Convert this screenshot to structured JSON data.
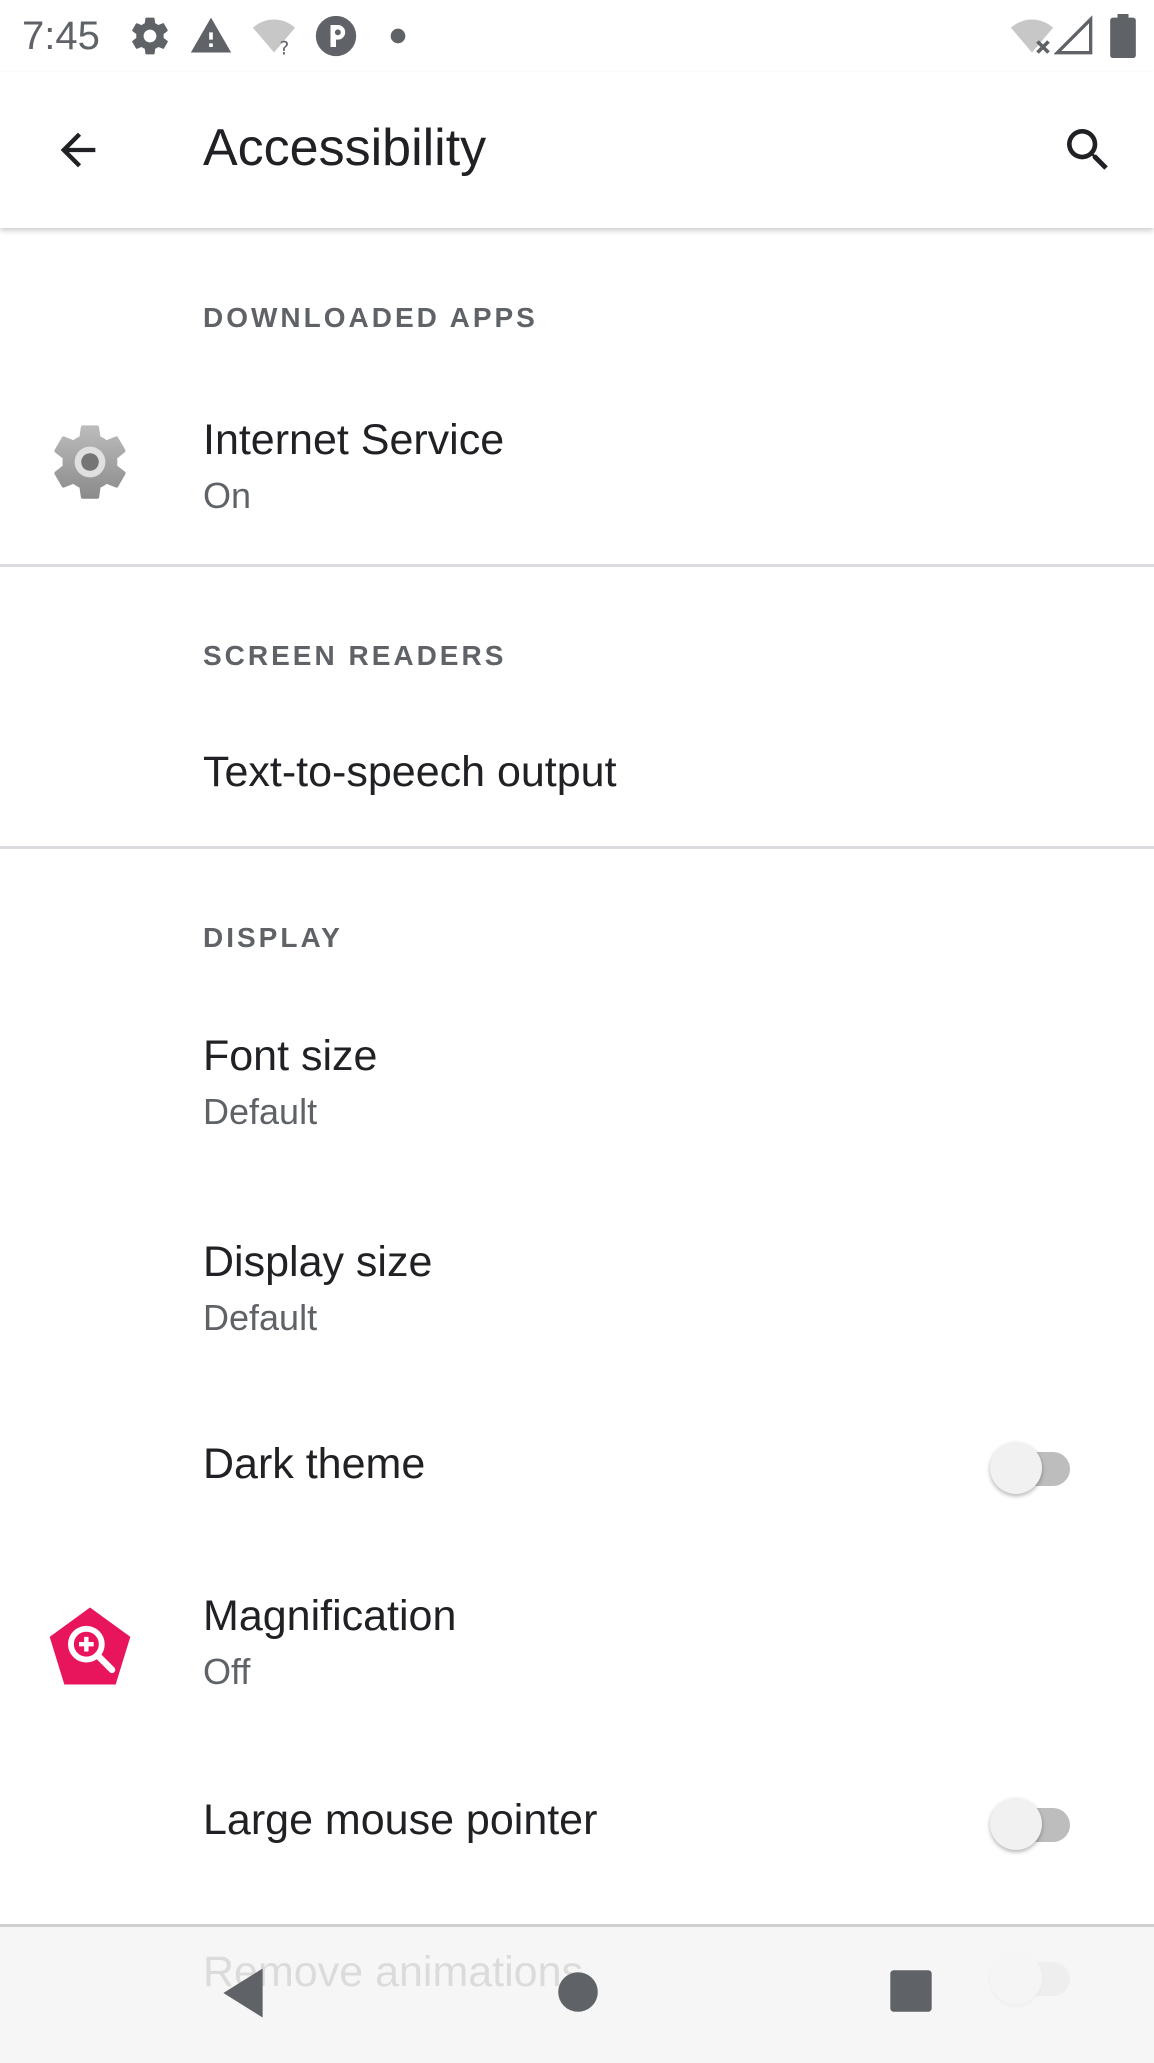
{
  "status_bar": {
    "time": "7:45",
    "icons": [
      "settings-icon",
      "warning-icon",
      "wifi-question-icon",
      "app-notification-icon",
      "dot-icon",
      "wifi-off-icon",
      "signal-icon",
      "battery-icon"
    ]
  },
  "app_bar": {
    "title": "Accessibility",
    "back_icon": "arrow-back-icon",
    "search_icon": "search-icon"
  },
  "sections": {
    "downloaded_apps": {
      "header": "DOWNLOADED APPS",
      "items": [
        {
          "title": "Internet Service",
          "subtitle": "On",
          "icon": "gear-icon"
        }
      ]
    },
    "screen_readers": {
      "header": "SCREEN READERS",
      "items": [
        {
          "title": "Text-to-speech output"
        }
      ]
    },
    "display": {
      "header": "DISPLAY",
      "items": [
        {
          "title": "Font size",
          "subtitle": "Default"
        },
        {
          "title": "Display size",
          "subtitle": "Default"
        },
        {
          "title": "Dark theme",
          "toggle": false
        },
        {
          "title": "Magnification",
          "subtitle": "Off",
          "icon": "magnification-icon"
        },
        {
          "title": "Large mouse pointer",
          "toggle": false
        },
        {
          "title": "Remove animations",
          "toggle": false
        }
      ]
    }
  },
  "colors": {
    "accent_magnification": "#e8145c",
    "toggle_track_off": "#bdbdbd",
    "toggle_thumb_off": "#f1f1f1"
  },
  "nav_bar": {
    "back": "nav-back-icon",
    "home": "nav-home-icon",
    "recents": "nav-recents-icon"
  }
}
